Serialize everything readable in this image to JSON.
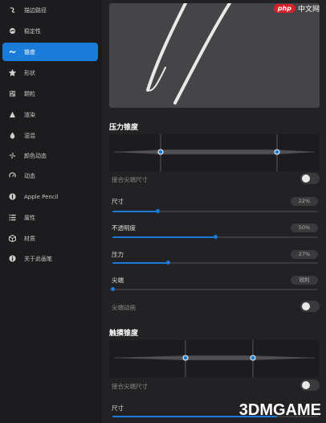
{
  "sidebar": {
    "items": [
      {
        "label": "描边路径",
        "icon": "stroke-path-icon",
        "active": false
      },
      {
        "label": "稳定性",
        "icon": "stabilization-icon",
        "active": false
      },
      {
        "label": "锥度",
        "icon": "taper-icon",
        "active": true
      },
      {
        "label": "形状",
        "icon": "shape-icon",
        "active": false
      },
      {
        "label": "颗粒",
        "icon": "grain-icon",
        "active": false
      },
      {
        "label": "渲染",
        "icon": "rendering-icon",
        "active": false
      },
      {
        "label": "湿混",
        "icon": "wet-mix-icon",
        "active": false
      },
      {
        "label": "颜色动态",
        "icon": "color-dynamics-icon",
        "active": false
      },
      {
        "label": "动态",
        "icon": "dynamics-icon",
        "active": false
      },
      {
        "label": "Apple Pencil",
        "icon": "apple-pencil-icon",
        "active": false
      },
      {
        "label": "属性",
        "icon": "properties-icon",
        "active": false
      },
      {
        "label": "材质",
        "icon": "materials-icon",
        "active": false
      },
      {
        "label": "关于此画笔",
        "icon": "info-icon",
        "active": false
      }
    ]
  },
  "pressure_taper": {
    "title": "压力锥度",
    "tip_size_label": "接合尖端尺寸",
    "tip_size_on": false,
    "size_label": "尺寸",
    "size_value": "22%",
    "size_level": 0.22,
    "opacity_label": "不透明度",
    "opacity_value": "50%",
    "opacity_level": 0.5,
    "pressure_label": "压力",
    "pressure_value": "27%",
    "pressure_level": 0.27,
    "tip_label": "尖端",
    "tip_value": "锐利",
    "tip_level": 0.0,
    "tip_animation_label": "尖端动画",
    "tip_animation_on": false
  },
  "touch_taper": {
    "title": "触摸锥度",
    "tip_size_label": "接合尖端尺寸",
    "tip_size_on": false,
    "size_label": "尺寸"
  },
  "watermarks": {
    "php_logo": "php",
    "php_text": "中文网",
    "site": "3DMGAME"
  },
  "colors": {
    "accent": "#1a7bd8",
    "panel": "#1c1c1e",
    "background": "#222224"
  }
}
